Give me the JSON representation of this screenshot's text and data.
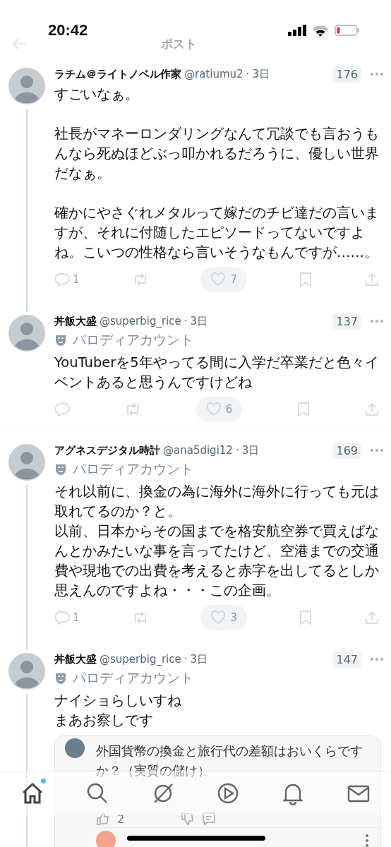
{
  "status_bar": {
    "time": "20:42"
  },
  "header": {
    "title": "ポスト"
  },
  "posts": [
    {
      "name": "ラチム＠ライトノベル作家",
      "handle": "@ratiumu2",
      "separator": "·",
      "time": "3日",
      "views": "176",
      "parody": false,
      "thread_below": true,
      "paragraphs": [
        [
          "すごいなぁ。"
        ],
        [
          "社長がマネーロンダリングなんて冗談でも言おうもんなら死ぬほどぶっ叩かれるだろうに、優しい世界だなぁ。"
        ],
        [
          "確かにやさぐれメタルって嫁だのチビ達だの言いますが、それに付随したエピソードってないですよね。こいつの性格なら言いそうなもんですが……。"
        ]
      ],
      "replies": "1",
      "likes": "7"
    },
    {
      "name": "丼飯大盛",
      "handle": "@superbig_rice",
      "separator": "·",
      "time": "3日",
      "views": "137",
      "parody": true,
      "parody_label": "パロディアカウント",
      "thread_below": false,
      "paragraphs": [
        [
          "YouTuberを5年やってる間に入学だ卒業だと色々イベントあると思うんですけどね"
        ]
      ],
      "likes": "6"
    },
    {
      "name": "アグネスデジタル時計",
      "handle": "@ana5digi12",
      "separator": "·",
      "time": "3日",
      "views": "169",
      "parody": true,
      "parody_label": "パロディアカウント",
      "thread_below": true,
      "paragraphs": [
        [
          "それ以前に、換金の為に海外に海外に行っても元は取れてるのか？と。",
          "以前、日本からその国までを格安航空券で買えばなんとかみたいな事を言ってたけど、空港までの交通費や現地での出費を考えると赤字を出してるとしか思えんのですよね・・・この企画。"
        ]
      ],
      "replies": "1",
      "likes": "3"
    },
    {
      "name": "丼飯大盛",
      "handle": "@superbig_rice",
      "separator": "·",
      "time": "3日",
      "views": "147",
      "parody": true,
      "parody_label": "パロディアカウント",
      "thread_below": true,
      "paragraphs": [
        [
          "ナイショらしいすね",
          "まあお察しです"
        ]
      ],
      "quote": {
        "text": "外国貨幣の換金と旅行代の差額はおいくらですか？（実質の儲け）",
        "likes": "2"
      }
    }
  ],
  "tab_bar": [
    {
      "kind": "home",
      "selected": true,
      "badge": true
    },
    {
      "kind": "search",
      "selected": false,
      "badge": false
    },
    {
      "kind": "grok",
      "selected": false,
      "badge": false
    },
    {
      "kind": "video",
      "selected": false,
      "badge": false
    },
    {
      "kind": "bell",
      "selected": false,
      "badge": false
    },
    {
      "kind": "mail",
      "selected": false,
      "badge": false
    }
  ]
}
